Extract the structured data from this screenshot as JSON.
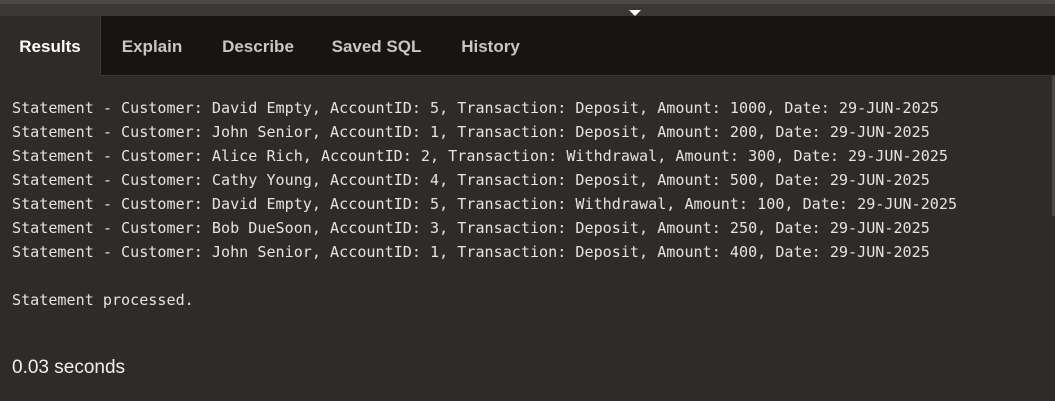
{
  "tabs": [
    {
      "label": "Results",
      "active": true
    },
    {
      "label": "Explain",
      "active": false
    },
    {
      "label": "Describe",
      "active": false
    },
    {
      "label": "Saved SQL",
      "active": false
    },
    {
      "label": "History",
      "active": false
    }
  ],
  "output": {
    "lines": [
      "Statement - Customer: David Empty, AccountID: 5, Transaction: Deposit, Amount: 1000, Date: 29-JUN-2025",
      "Statement - Customer: John Senior, AccountID: 1, Transaction: Deposit, Amount: 200, Date: 29-JUN-2025",
      "Statement - Customer: Alice Rich, AccountID: 2, Transaction: Withdrawal, Amount: 300, Date: 29-JUN-2025",
      "Statement - Customer: Cathy Young, AccountID: 4, Transaction: Deposit, Amount: 500, Date: 29-JUN-2025",
      "Statement - Customer: David Empty, AccountID: 5, Transaction: Withdrawal, Amount: 100, Date: 29-JUN-2025",
      "Statement - Customer: Bob DueSoon, AccountID: 3, Transaction: Deposit, Amount: 250, Date: 29-JUN-2025",
      "Statement - Customer: John Senior, AccountID: 1, Transaction: Deposit, Amount: 400, Date: 29-JUN-2025"
    ],
    "processed": "Statement processed.",
    "elapsed": "0.03 seconds"
  },
  "icons": {
    "splitter": "chevron-down-icon"
  },
  "colors": {
    "background": "#2e2b29",
    "tabbar": "#161513",
    "text": "#e6e3e0"
  }
}
